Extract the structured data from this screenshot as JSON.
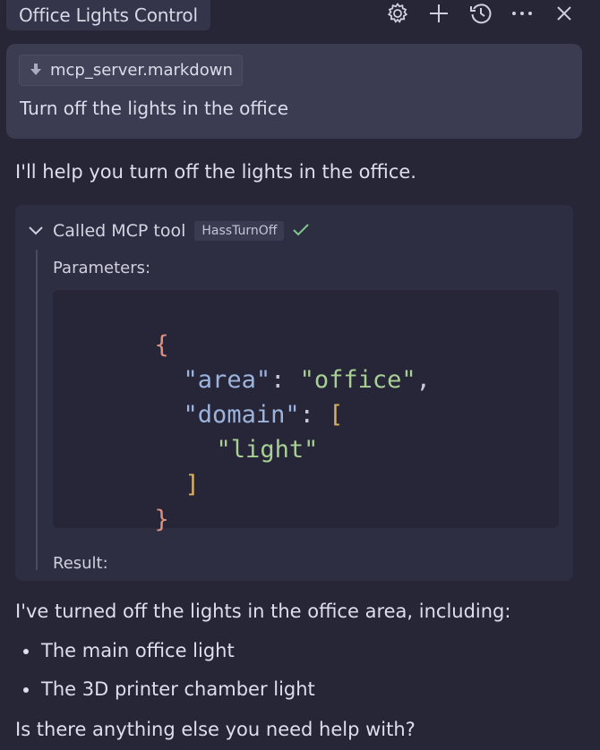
{
  "header": {
    "title": "Office Lights Control",
    "icons": [
      "settings-gear-icon",
      "plus-icon",
      "history-icon",
      "more-horizontal-icon",
      "close-icon"
    ]
  },
  "user_message": {
    "attachment": {
      "icon": "arrow-down-icon",
      "label": "mcp_server.markdown"
    },
    "text": "Turn off the lights in the office"
  },
  "assistant": {
    "intro": "I'll help you turn off the lights in the office.",
    "tool_call": {
      "label": "Called MCP tool",
      "tool_name": "HassTurnOff",
      "status_icon": "checkmark-icon",
      "params_label": "Parameters:",
      "code": {
        "open_brace": "{",
        "area_key": "\"area\"",
        "area_value": "\"office\"",
        "domain_key": "\"domain\"",
        "open_bracket": "[",
        "domain_item": "\"light\"",
        "close_bracket": "]",
        "close_brace": "}"
      },
      "result_label": "Result:"
    },
    "summary": "I've turned off the lights in the office area, including:",
    "items": [
      "The main office light",
      "The 3D printer chamber light"
    ],
    "question": "Is there anything else you need help with?"
  },
  "colors": {
    "background": "#262637",
    "card": "#3b3b52",
    "tool_block": "#2e2e42",
    "code_bg": "#262638",
    "success": "#7fc78e",
    "json_key": "#9cb3dc",
    "json_string": "#a8cf94",
    "json_brace": "#e0907e",
    "json_bracket": "#d9b15f"
  }
}
